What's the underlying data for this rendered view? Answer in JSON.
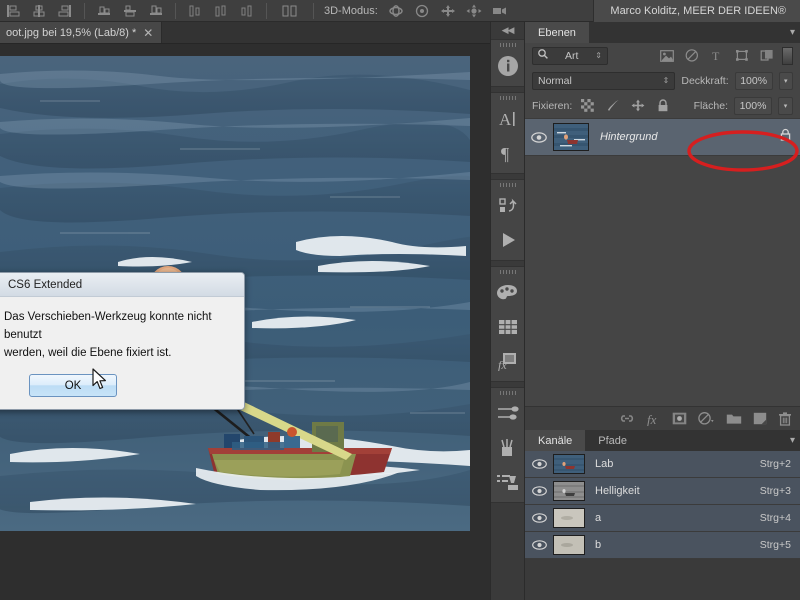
{
  "app": {
    "title": "Adobe Photoshop CS6 Extended",
    "accent": "#5a6470",
    "annotation_color": "#d61f1f"
  },
  "options_bar": {
    "align_icons": [
      "align-left-edges-icon",
      "align-horizontal-centers-icon",
      "align-right-edges-icon"
    ],
    "distribute_icons": [
      "align-top-edges-icon",
      "align-vertical-centers-icon",
      "align-bottom-edges-icon"
    ],
    "distribute2_icons": [
      "distribute-left-icon",
      "distribute-center-icon",
      "distribute-right-icon"
    ],
    "auto_align_icon": "auto-align-layers-icon",
    "mode_3d_label": "3D-Modus:",
    "mode_3d_icons": [
      "rotate-3d-object-icon",
      "roll-3d-object-icon",
      "pan-3d-object-icon",
      "slide-3d-object-icon",
      "scale-3d-object-icon"
    ],
    "user_badge": "Marco Kolditz, MEER DER IDEEN®"
  },
  "document": {
    "tab_label": "oot.jpg bei 19,5% (Lab/8) *",
    "close_glyph": "✕",
    "zoom": "19,5%",
    "color_mode": "Lab/8",
    "modified": true
  },
  "icon_dock": {
    "collapse_glyph": "◀◀",
    "groups": [
      {
        "icons": [
          "info-icon"
        ]
      },
      {
        "icons": [
          "character-icon",
          "paragraph-icon"
        ]
      },
      {
        "icons": [
          "history-icon",
          "actions-play-icon"
        ]
      },
      {
        "icons": [
          "swatches-palette-icon",
          "color-grid-icon",
          "layer-styles-fx-icon"
        ]
      },
      {
        "icons": [
          "brush-settings-icon",
          "brush-presets-icon",
          "clone-source-icon"
        ]
      }
    ]
  },
  "layers_panel": {
    "tabs": [
      {
        "label": "Ebenen",
        "active": true
      }
    ],
    "menu_glyph": "▾",
    "filter": {
      "icon": "search-icon",
      "value": "Art",
      "spin_glyph": "⇕"
    },
    "filter_type_icons": [
      "filter-pixel-icon",
      "filter-adjustment-icon",
      "filter-type-icon",
      "filter-shape-icon",
      "filter-smartobject-icon"
    ],
    "filter_toggle": "filter-enable-toggle",
    "blend_mode": {
      "value": "Normal",
      "spin_glyph": "⇕"
    },
    "opacity": {
      "label": "Deckkraft:",
      "value": "100%",
      "dd_glyph": "▾"
    },
    "lock": {
      "label": "Fixieren:",
      "icons": [
        "lock-transparent-pixels-icon",
        "lock-image-pixels-icon",
        "lock-position-icon",
        "lock-all-icon"
      ]
    },
    "fill": {
      "label": "Fläche:",
      "value": "100%",
      "dd_glyph": "▾"
    },
    "layers": [
      {
        "name": "Hintergrund",
        "visible": true,
        "eye_icon": "eye-icon",
        "locked": true,
        "lock_icon": "lock-icon",
        "selected": true,
        "italic": true
      }
    ],
    "footer_icons": [
      "link-layers-icon",
      "add-layer-style-fx-icon",
      "add-layer-mask-icon",
      "new-adjustment-layer-icon",
      "new-group-icon",
      "new-layer-icon",
      "delete-layer-icon"
    ]
  },
  "channels_panel": {
    "tabs": [
      {
        "label": "Kanäle",
        "active": true
      },
      {
        "label": "Pfade",
        "active": false
      }
    ],
    "menu_glyph": "▾",
    "channels": [
      {
        "name": "Lab",
        "shortcut": "Strg+2",
        "visible": true,
        "eye_icon": "eye-icon"
      },
      {
        "name": "Helligkeit",
        "shortcut": "Strg+3",
        "visible": true,
        "eye_icon": "eye-icon"
      },
      {
        "name": "a",
        "shortcut": "Strg+4",
        "visible": true,
        "eye_icon": "eye-icon"
      },
      {
        "name": "b",
        "shortcut": "Strg+5",
        "visible": true,
        "eye_icon": "eye-icon"
      }
    ]
  },
  "dialog": {
    "title": "CS6 Extended",
    "message_line1": "Das Verschieben-Werkzeug konnte nicht benutzt",
    "message_line2": "werden, weil die Ebene fixiert ist.",
    "ok_label": "OK"
  },
  "cursor": {
    "type": "arrow-pointer"
  }
}
